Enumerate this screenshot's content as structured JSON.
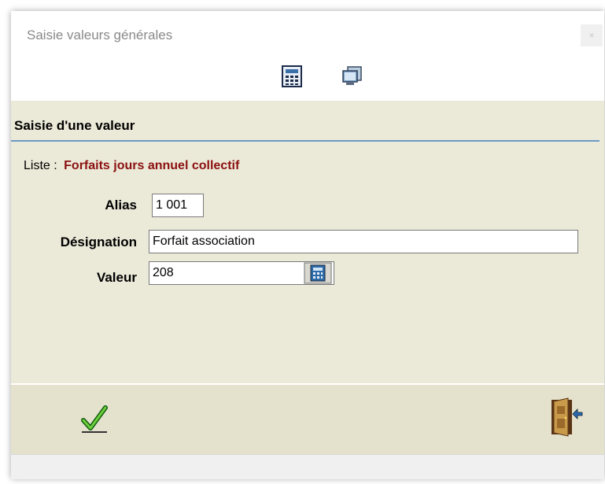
{
  "window": {
    "title": "Saisie valeurs générales",
    "close_glyph": "×"
  },
  "toolbar": {
    "icons": [
      "calculator-icon",
      "monitor-icon"
    ]
  },
  "section": {
    "title": "Saisie d'une valeur"
  },
  "list": {
    "label": "Liste :",
    "value": "Forfaits jours annuel collectif"
  },
  "form": {
    "alias_label": "Alias",
    "alias_value": "1 001",
    "designation_label": "Désignation",
    "designation_value": "Forfait association",
    "valeur_label": "Valeur",
    "valeur_value": "208"
  },
  "actions": {
    "validate_icon": "checkmark-icon",
    "exit_icon": "exit-door-icon"
  },
  "colors": {
    "panel_bg": "#ebe9d8",
    "accent_line": "#6a9ac6",
    "list_value": "#8b1010"
  }
}
